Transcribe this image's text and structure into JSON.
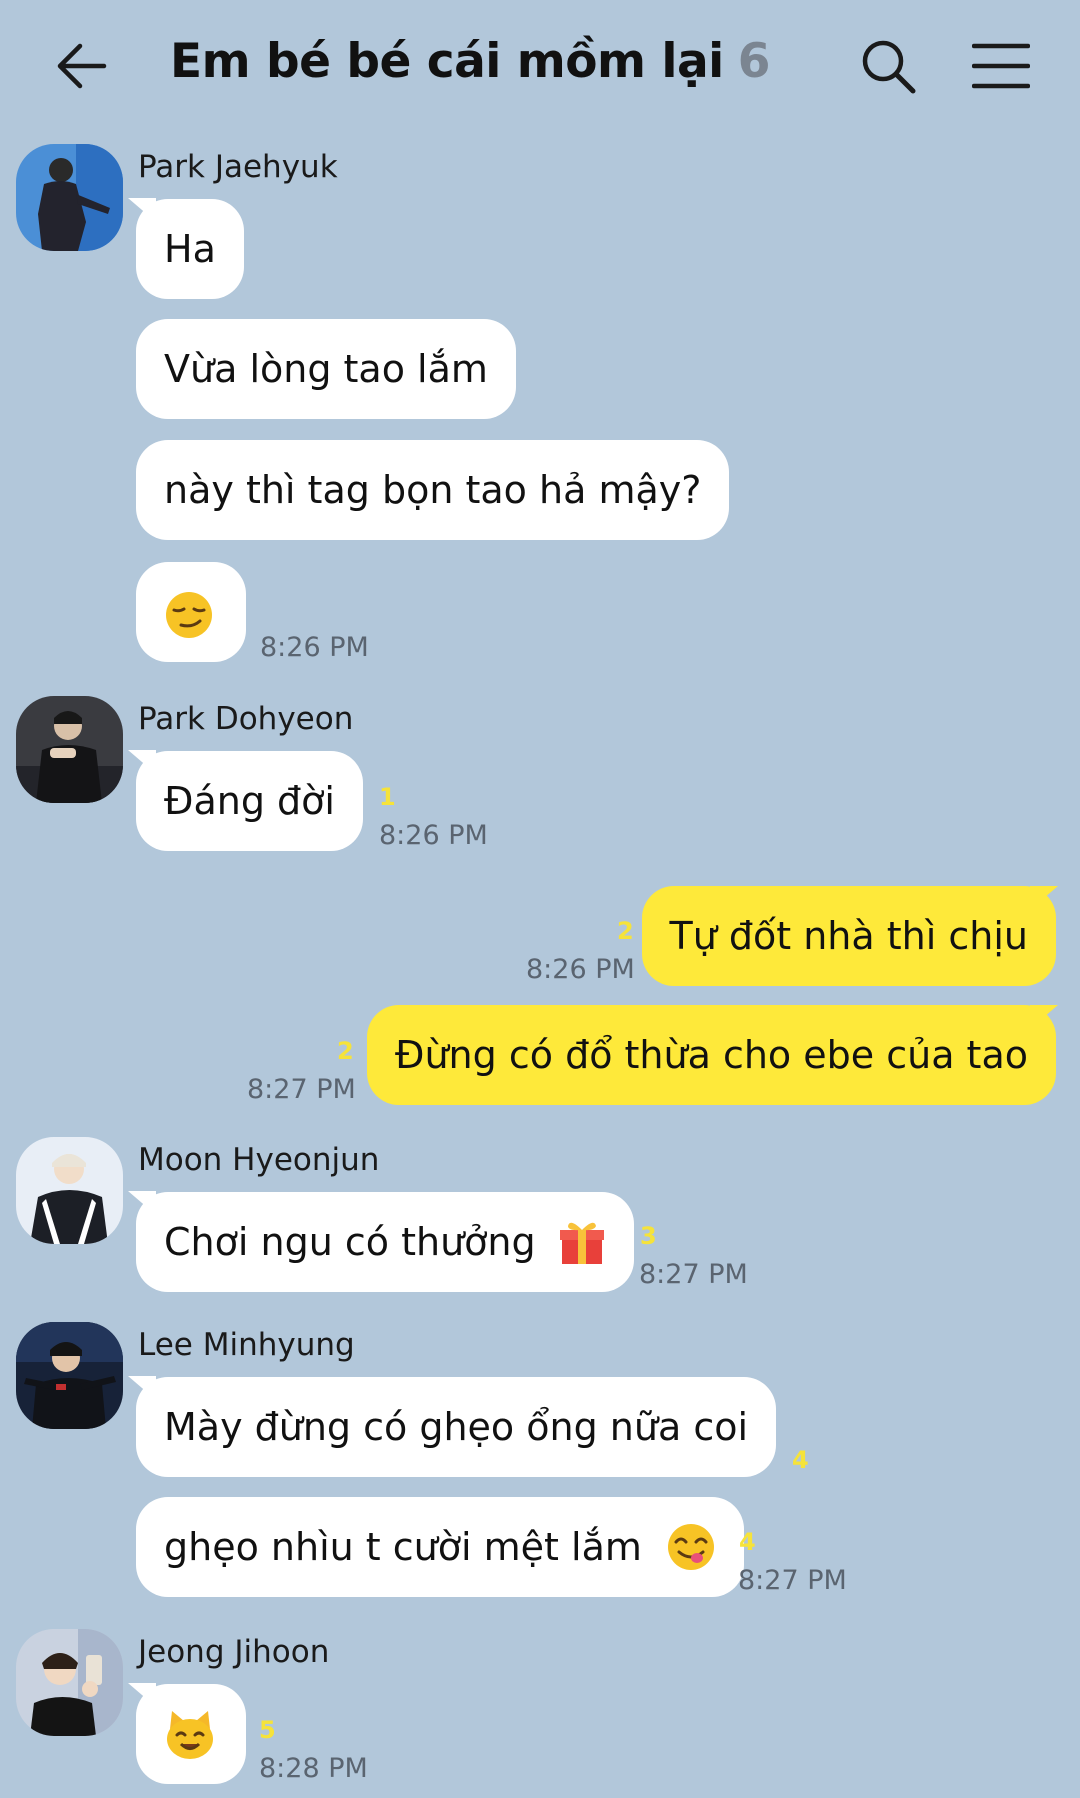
{
  "header": {
    "title": "Em bé bé cái mồm lại",
    "member_count": "6",
    "back_icon": "arrow-left-icon",
    "search_icon": "search-icon",
    "menu_icon": "hamburger-menu-icon"
  },
  "colors": {
    "background": "#b2c7da",
    "incoming_bubble": "#ffffff",
    "outgoing_bubble": "#fee93a",
    "unread_count": "#f6e33a"
  },
  "messages": {
    "jaehyuk": {
      "name": "Park Jaehyuk",
      "m1": "Ha",
      "m2": "Vừa lòng tao lắm",
      "m3": "này thì tag bọn tao hả mậy?",
      "m4_emoji": "smirk-emoji",
      "time": "8:26 PM"
    },
    "dohyeon": {
      "name": "Park Dohyeon",
      "m1": "Đáng đời",
      "unread": "1",
      "time": "8:26 PM"
    },
    "me": {
      "m1": "Tự đốt nhà thì chịu",
      "m1_unread": "2",
      "m1_time": "8:26 PM",
      "m2": "Đừng có đổ thừa cho ebe của tao",
      "m2_unread": "2",
      "m2_time": "8:27 PM"
    },
    "hyeonjun": {
      "name": "Moon Hyeonjun",
      "m1": "Chơi ngu có thưởng",
      "m1_emoji": "gift-emoji",
      "unread": "3",
      "time": "8:27 PM"
    },
    "minhyung": {
      "name": "Lee Minhyung",
      "m1": "Mày đừng có ghẹo ổng nữa coi",
      "m1_unread": "4",
      "m2": "ghẹo nhìu t cười mệt lắm",
      "m2_emoji": "yum-face-emoji",
      "m2_unread": "4",
      "time": "8:27 PM"
    },
    "jihoon": {
      "name": "Jeong Jihoon",
      "m1_emoji": "cat-face-emoji",
      "unread": "5",
      "time": "8:28 PM"
    }
  }
}
